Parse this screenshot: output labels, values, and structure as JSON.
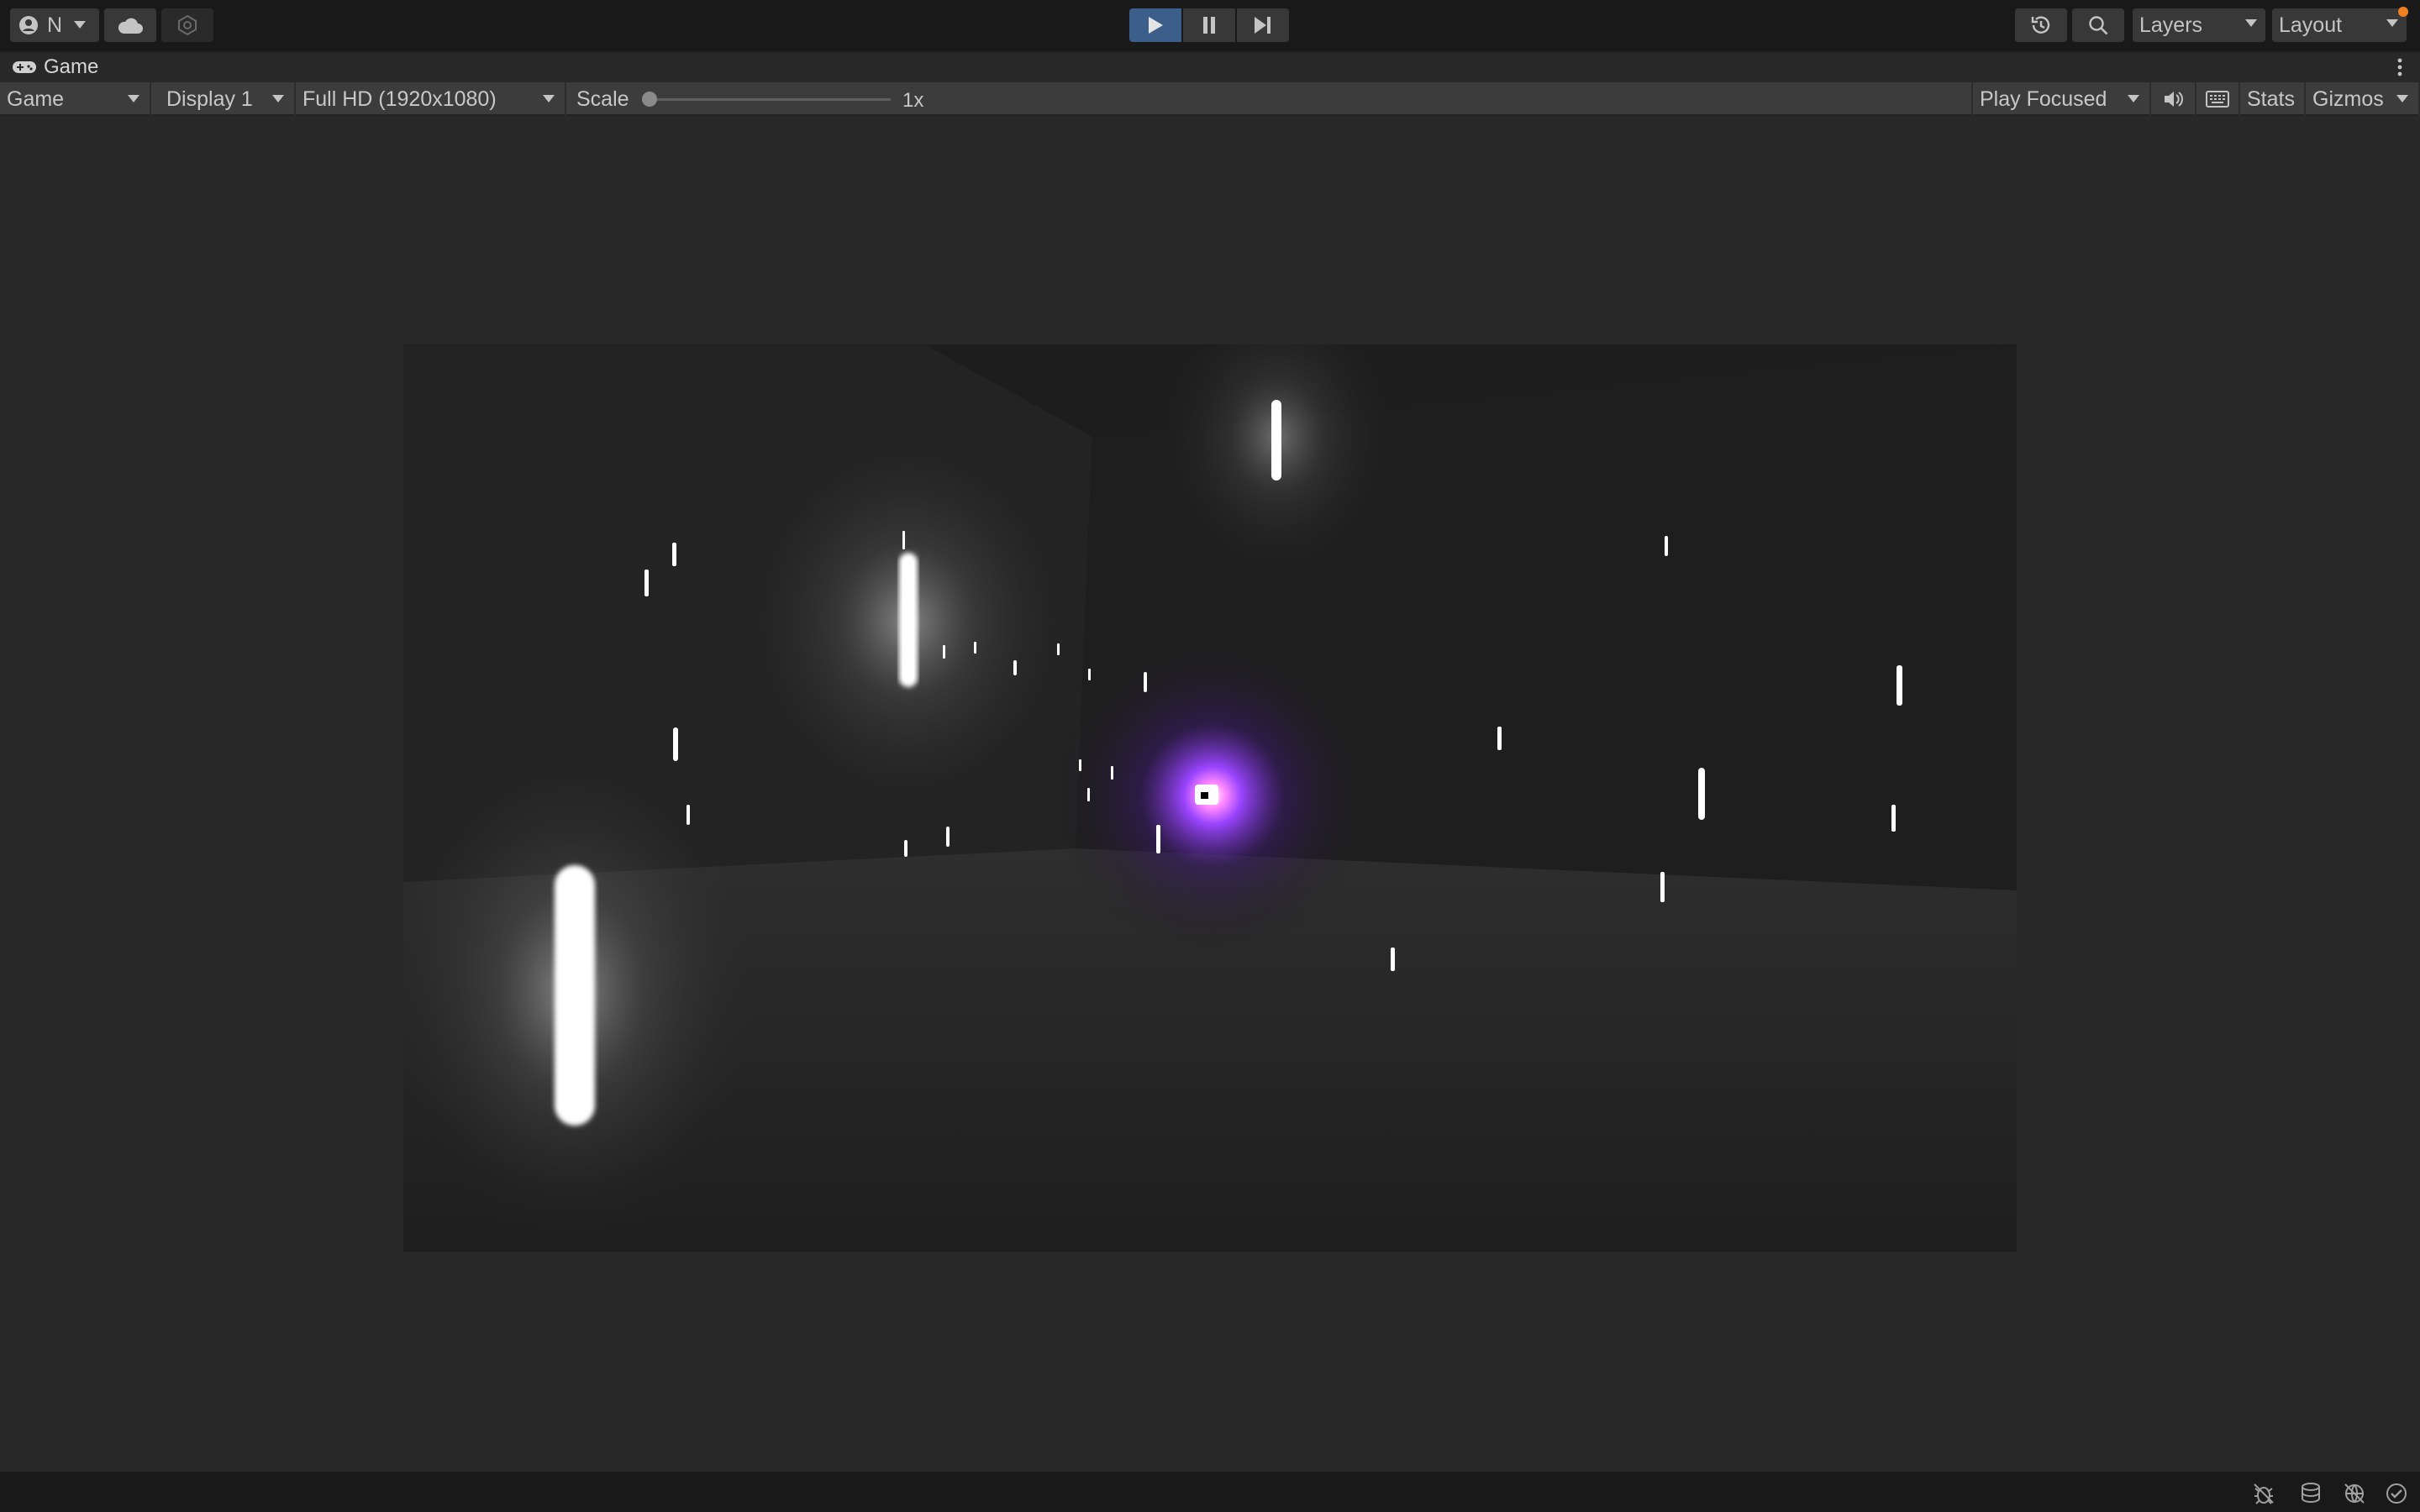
{
  "toolbar": {
    "account_label": "N",
    "icons": {
      "account": "account-icon",
      "cloud": "cloud-icon",
      "collab": "collab-icon",
      "play": "play-icon",
      "pause": "pause-icon",
      "step": "step-icon",
      "history": "history-icon",
      "search": "search-icon"
    },
    "layers_label": "Layers",
    "layout_label": "Layout"
  },
  "tab": {
    "title": "Game",
    "icon": "gamepad-icon"
  },
  "gamebar": {
    "view_mode": "Game",
    "display": "Display 1",
    "resolution": "Full HD (1920x1080)",
    "scale_label": "Scale",
    "scale_value": "1x",
    "play_mode": "Play Focused",
    "stats_label": "Stats",
    "gizmos_label": "Gizmos"
  },
  "status_icons": [
    "debug-icon",
    "cache-server-icon",
    "network-icon",
    "check-icon"
  ],
  "colors": {
    "accent_play": "#3b5f8a",
    "notify": "#f08020",
    "orb": "#8844ff"
  }
}
